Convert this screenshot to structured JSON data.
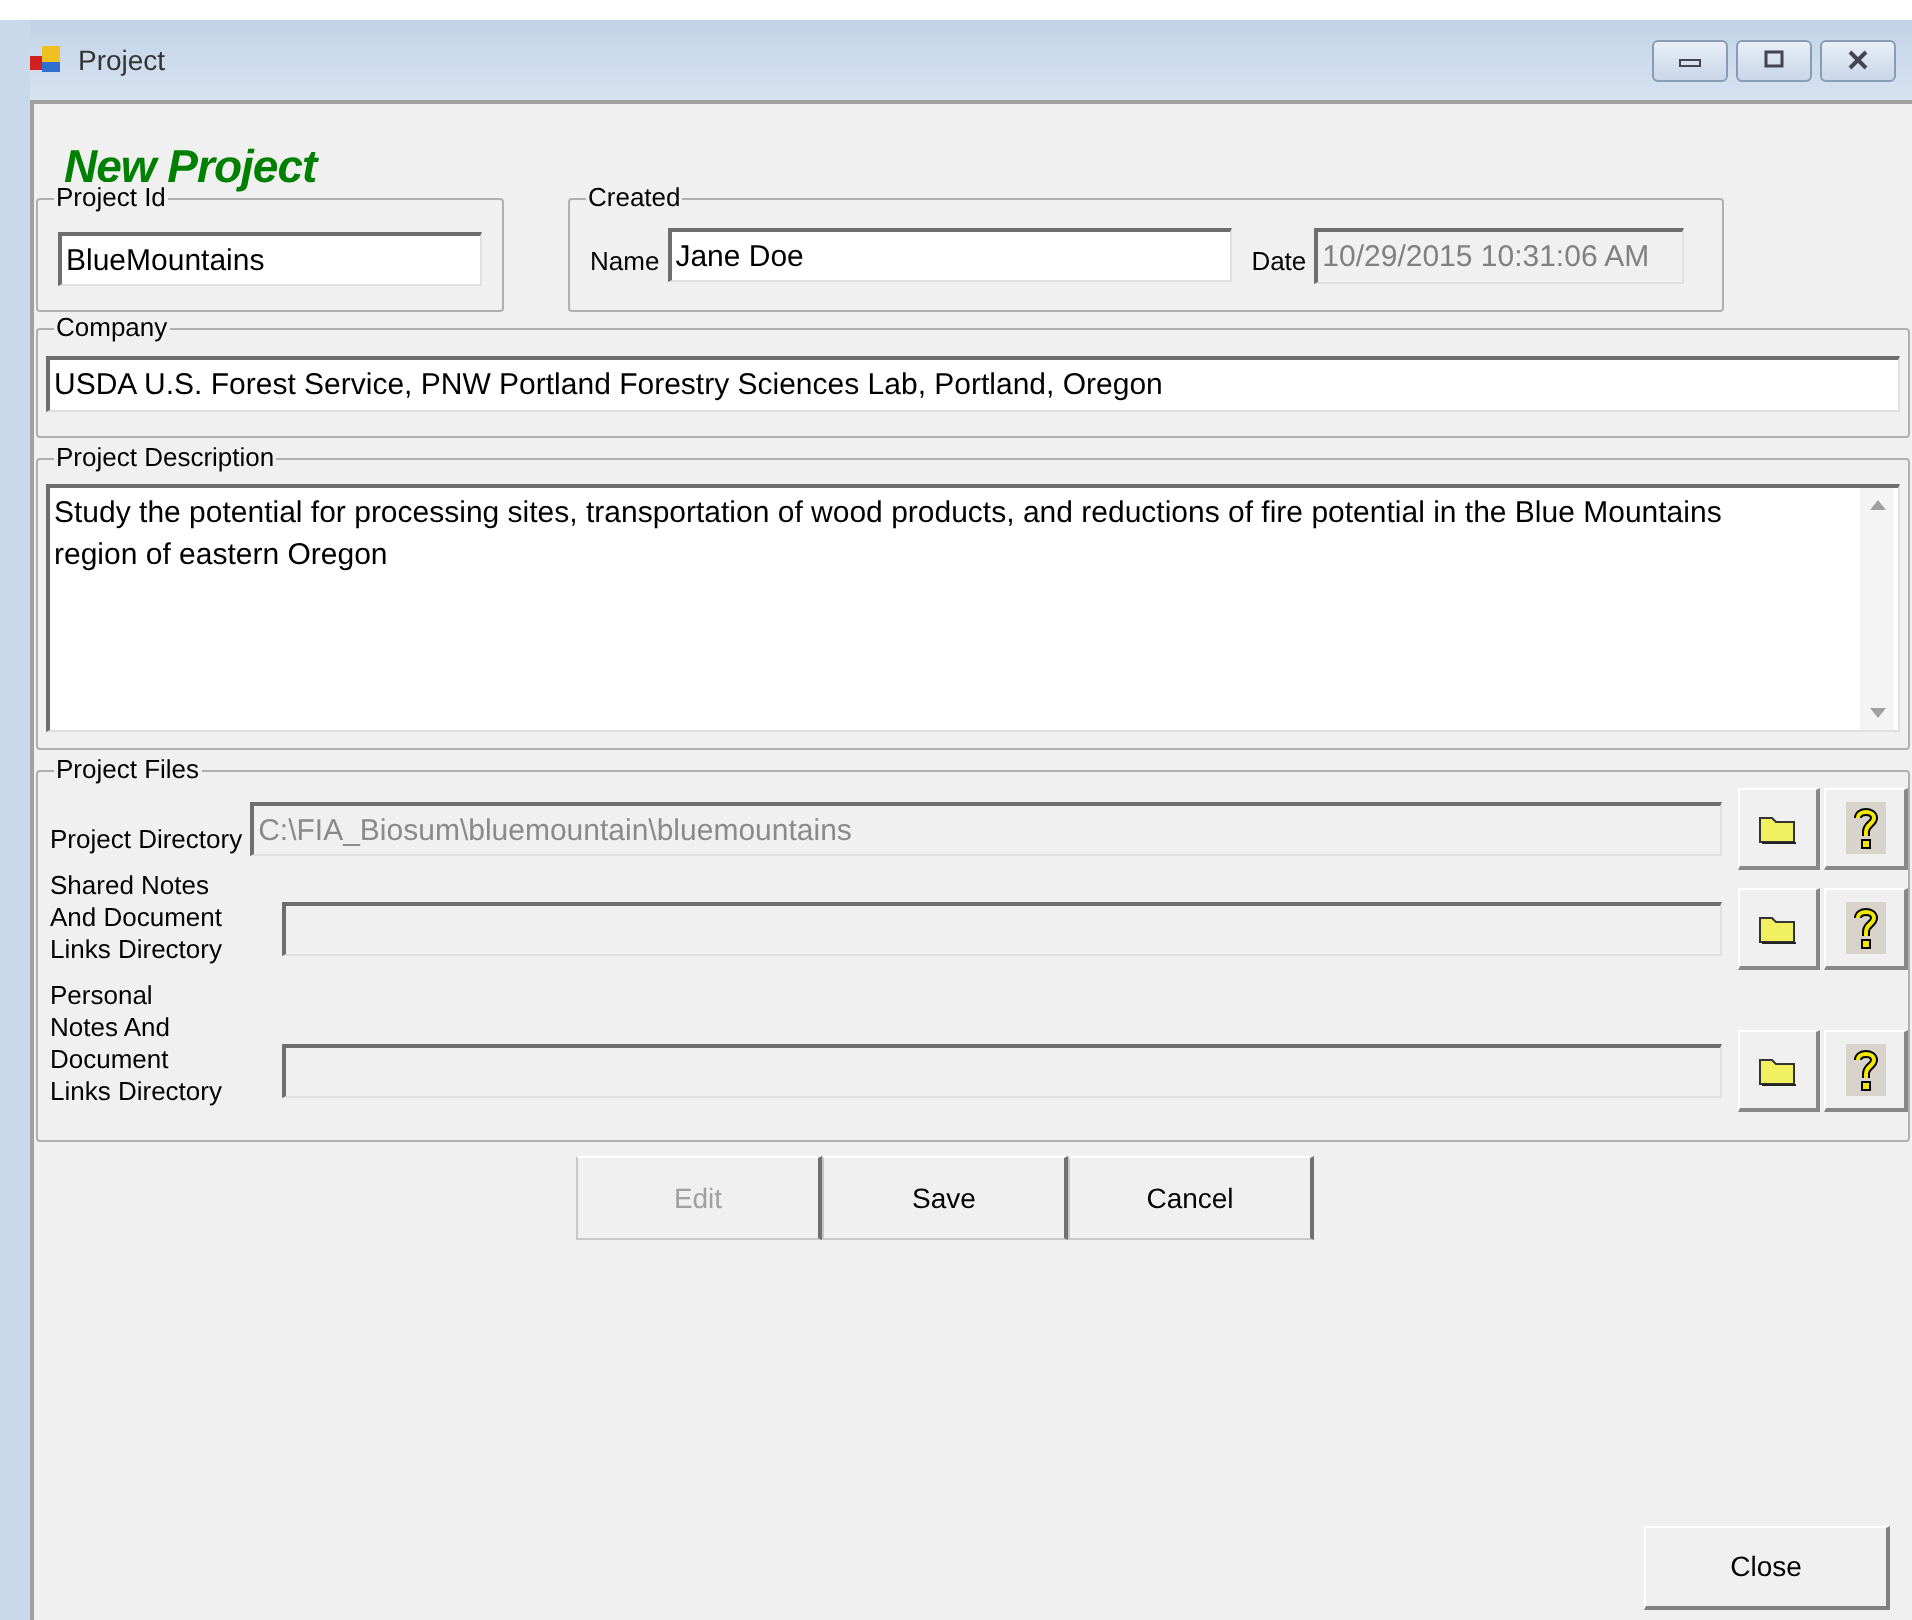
{
  "window": {
    "title": "Project"
  },
  "heading": "New Project",
  "project_id": {
    "label": "Project Id",
    "value": "BlueMountains"
  },
  "created": {
    "label": "Created",
    "name_label": "Name",
    "name_value": "Jane Doe",
    "date_label": "Date",
    "date_value": "10/29/2015 10:31:06 AM",
    "date_disabled": true
  },
  "company": {
    "label": "Company",
    "value": "USDA U.S. Forest Service, PNW Portland Forestry Sciences Lab, Portland, Oregon"
  },
  "description": {
    "label": "Project Description",
    "value": "Study the potential for processing sites, transportation of wood products, and reductions of fire potential in the Blue Mountains region of eastern Oregon"
  },
  "project_files": {
    "label": "Project Files",
    "rows": [
      {
        "label": "Project Directory",
        "value": "C:\\FIA_Biosum\\bluemountain\\bluemountains",
        "disabled": true
      },
      {
        "label": "Shared Notes\nAnd Document\nLinks Directory",
        "disabled": true
      },
      {
        "label": "Personal\nNotes And\nDocument\nLinks Directory",
        "disabled": true
      }
    ]
  },
  "buttons": [
    {
      "label": "Edit",
      "disabled": true
    },
    {
      "label": "Save",
      "disabled": false
    },
    {
      "label": "Cancel",
      "disabled": false
    }
  ],
  "close_button": "Close"
}
